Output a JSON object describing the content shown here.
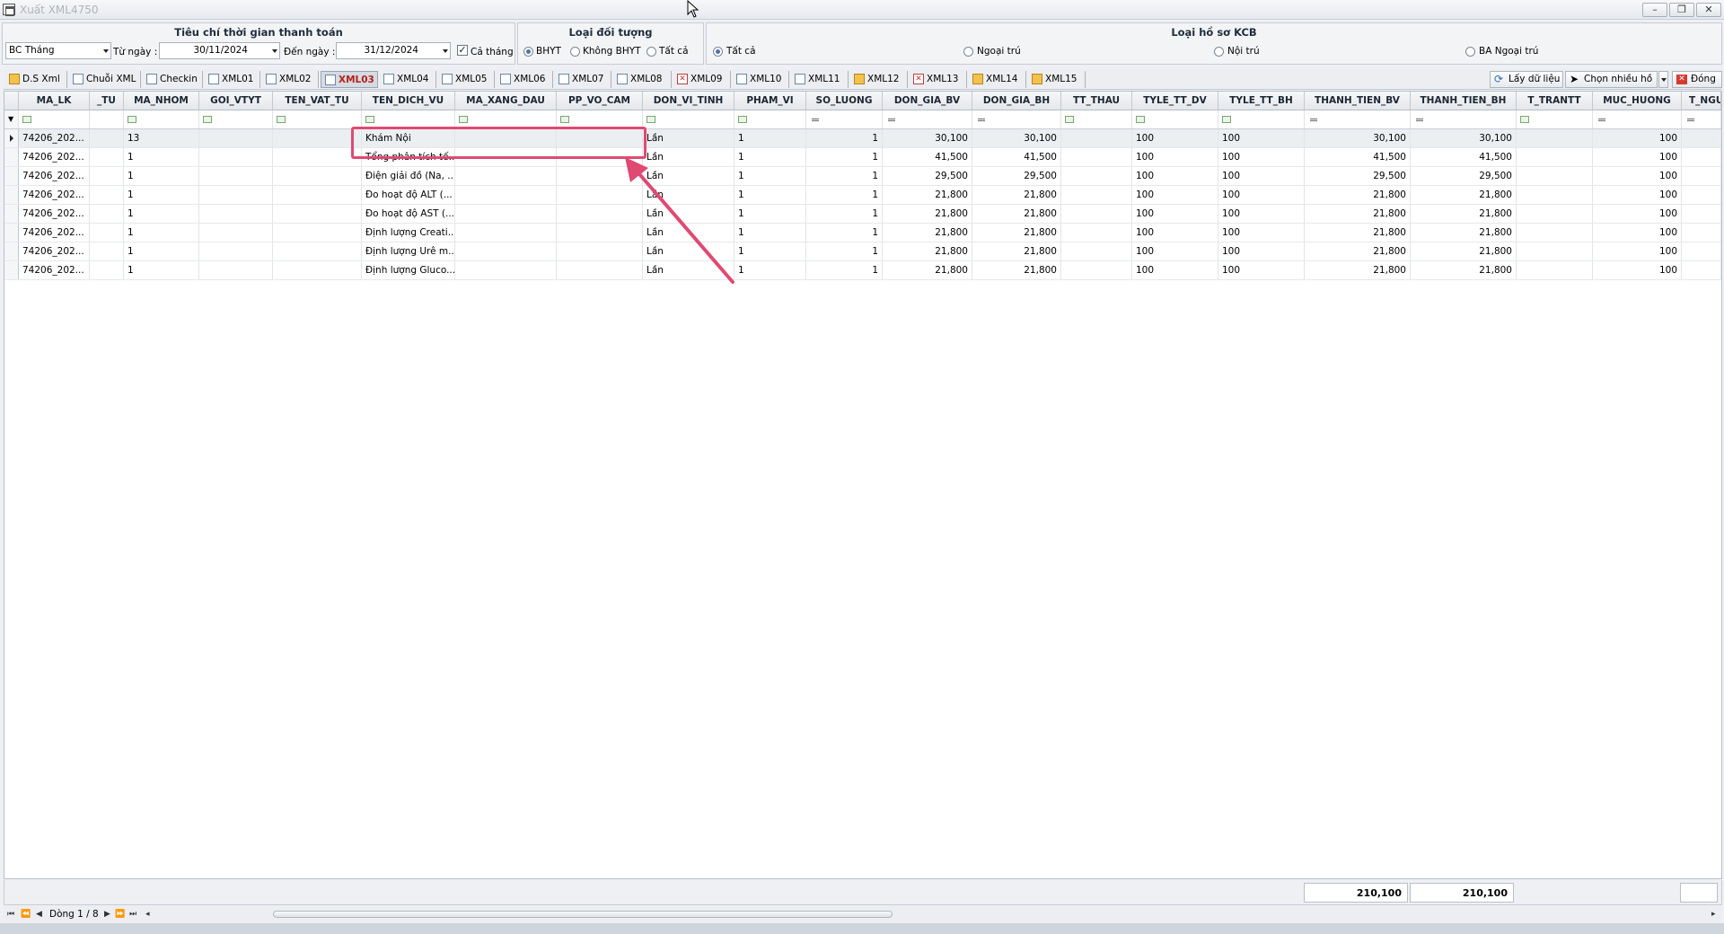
{
  "window": {
    "title": "Xuất XML4750"
  },
  "filters": {
    "time_panel_title": "Tiêu chí thời gian thanh toán",
    "report_type": "BC Tháng",
    "from_label": "Từ ngày :",
    "from_date": "30/11/2024",
    "to_label": "Đến ngày :",
    "to_date": "31/12/2024",
    "whole_month_label": "Cả tháng",
    "whole_month_checked": true,
    "subject_panel_title": "Loại đối tượng",
    "subject_options": [
      "BHYT",
      "Không BHYT",
      "Tất cả"
    ],
    "subject_selected": "BHYT",
    "record_panel_title": "Loại hồ sơ KCB",
    "record_options": [
      "Tất cả",
      "Ngoại trú",
      "Nội trú",
      "BA Ngoại trú"
    ],
    "record_selected": "Tất cả"
  },
  "tabs": [
    "D.S Xml",
    "Chuỗi XML",
    "Checkin",
    "XML01",
    "XML02",
    "XML03",
    "XML04",
    "XML05",
    "XML06",
    "XML07",
    "XML08",
    "XML09",
    "XML10",
    "XML11",
    "XML12",
    "XML13",
    "XML14",
    "XML15"
  ],
  "active_tab": "XML03",
  "toolbar": {
    "fetch_label": "Lấy dữ liệu",
    "multi_label": "Chọn nhiều hồ sơ",
    "close_label": "Đóng"
  },
  "grid": {
    "columns": [
      "MA_LK",
      "_TU",
      "MA_NHOM",
      "GOI_VTYT",
      "TEN_VAT_TU",
      "TEN_DICH_VU",
      "MA_XANG_DAU",
      "PP_VO_CAM",
      "DON_VI_TINH",
      "PHAM_VI",
      "SO_LUONG",
      "DON_GIA_BV",
      "DON_GIA_BH",
      "TT_THAU",
      "TYLE_TT_DV",
      "TYLE_TT_BH",
      "THANH_TIEN_BV",
      "THANH_TIEN_BH",
      "T_TRANTT",
      "MUC_HUONG",
      "T_NGU"
    ],
    "rows": [
      [
        "74206_202...",
        "",
        "13",
        "",
        "",
        "Khám Nội",
        "",
        "",
        "Lần",
        "1",
        "1",
        "30,100",
        "30,100",
        "",
        "100",
        "100",
        "30,100",
        "30,100",
        "",
        "100",
        ""
      ],
      [
        "74206_202...",
        "",
        "1",
        "",
        "",
        "Tổng phân tích tế...",
        "",
        "",
        "Lần",
        "1",
        "1",
        "41,500",
        "41,500",
        "",
        "100",
        "100",
        "41,500",
        "41,500",
        "",
        "100",
        ""
      ],
      [
        "74206_202...",
        "",
        "1",
        "",
        "",
        "Điện giải đồ (Na, ...",
        "",
        "",
        "Lần",
        "1",
        "1",
        "29,500",
        "29,500",
        "",
        "100",
        "100",
        "29,500",
        "29,500",
        "",
        "100",
        ""
      ],
      [
        "74206_202...",
        "",
        "1",
        "",
        "",
        "Đo hoạt độ ALT (...",
        "",
        "",
        "Lần",
        "1",
        "1",
        "21,800",
        "21,800",
        "",
        "100",
        "100",
        "21,800",
        "21,800",
        "",
        "100",
        ""
      ],
      [
        "74206_202...",
        "",
        "1",
        "",
        "",
        "Đo hoạt độ AST (...",
        "",
        "",
        "Lần",
        "1",
        "1",
        "21,800",
        "21,800",
        "",
        "100",
        "100",
        "21,800",
        "21,800",
        "",
        "100",
        ""
      ],
      [
        "74206_202...",
        "",
        "1",
        "",
        "",
        "Định lượng Creati...",
        "",
        "",
        "Lần",
        "1",
        "1",
        "21,800",
        "21,800",
        "",
        "100",
        "100",
        "21,800",
        "21,800",
        "",
        "100",
        ""
      ],
      [
        "74206_202...",
        "",
        "1",
        "",
        "",
        "Định lượng Urê m...",
        "",
        "",
        "Lần",
        "1",
        "1",
        "21,800",
        "21,800",
        "",
        "100",
        "100",
        "21,800",
        "21,800",
        "",
        "100",
        ""
      ],
      [
        "74206_202...",
        "",
        "1",
        "",
        "",
        "Định lượng Gluco...",
        "",
        "",
        "Lần",
        "1",
        "1",
        "21,800",
        "21,800",
        "",
        "100",
        "100",
        "21,800",
        "21,800",
        "",
        "100",
        ""
      ]
    ],
    "totals": {
      "thanh_tien_bv": "210,100",
      "thanh_tien_bh": "210,100"
    }
  },
  "pager": {
    "record_text": "Dòng 1 / 8"
  },
  "colors": {
    "highlight": "#e04a72",
    "active_tab_text": "#b5211b"
  }
}
